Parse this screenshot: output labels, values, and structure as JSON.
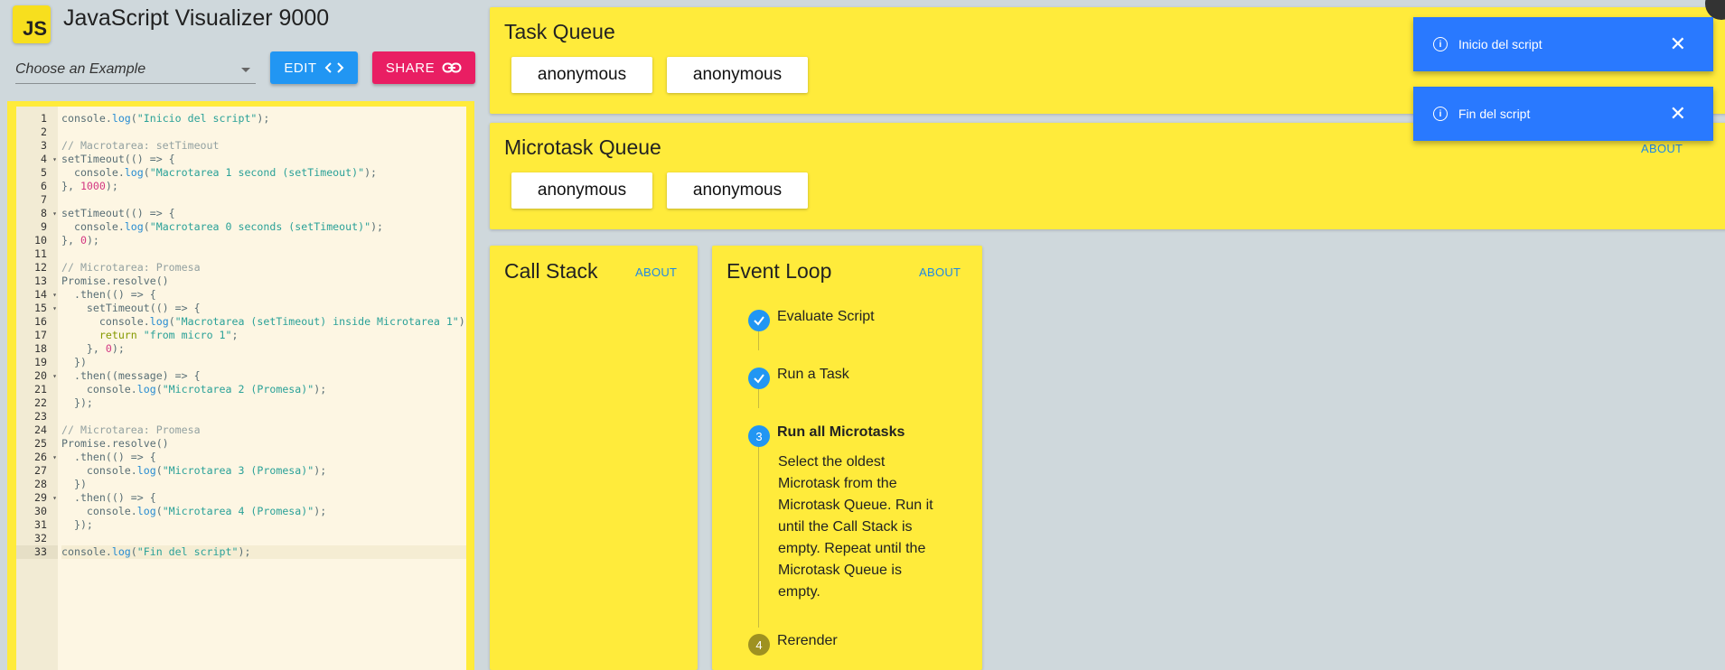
{
  "header": {
    "logo_text": "JS",
    "title": "JavaScript Visualizer 9000",
    "example_placeholder": "Choose an Example",
    "edit_label": "EDIT",
    "share_label": "SHARE"
  },
  "editor": {
    "active_line": 33,
    "lines": [
      "console.log(\"Inicio del script\");",
      "",
      "// Macrotarea: setTimeout",
      "setTimeout(() => {",
      "  console.log(\"Macrotarea 1 second (setTimeout)\");",
      "}, 1000);",
      "",
      "setTimeout(() => {",
      "  console.log(\"Macrotarea 0 seconds (setTimeout)\");",
      "}, 0);",
      "",
      "// Microtarea: Promesa",
      "Promise.resolve()",
      "  .then(() => {",
      "    setTimeout(() => {",
      "      console.log(\"Macrotarea (setTimeout) inside Microtarea 1\")",
      "      return \"from micro 1\";",
      "    }, 0);",
      "  })",
      "  .then((message) => {",
      "    console.log(\"Microtarea 2 (Promesa)\");",
      "  });",
      "",
      "// Microtarea: Promesa",
      "Promise.resolve()",
      "  .then(() => {",
      "    console.log(\"Microtarea 3 (Promesa)\");",
      "  })",
      "  .then(() => {",
      "    console.log(\"Microtarea 4 (Promesa)\");",
      "  });",
      "",
      "console.log(\"Fin del script\");"
    ],
    "fold_lines": [
      4,
      8,
      14,
      15,
      20,
      26,
      29
    ]
  },
  "task_queue": {
    "title": "Task Queue",
    "items": [
      "anonymous",
      "anonymous"
    ]
  },
  "microtask_queue": {
    "title": "Microtask Queue",
    "about": "ABOUT",
    "items": [
      "anonymous",
      "anonymous"
    ]
  },
  "call_stack": {
    "title": "Call Stack",
    "about": "ABOUT"
  },
  "event_loop": {
    "title": "Event Loop",
    "about": "ABOUT",
    "steps": [
      {
        "label": "Evaluate Script",
        "state": "done",
        "number": "1"
      },
      {
        "label": "Run a Task",
        "state": "done",
        "number": "2"
      },
      {
        "label": "Run all Microtasks",
        "state": "active",
        "number": "3",
        "description": "Select the oldest Microtask from the Microtask Queue. Run it until the Call Stack is empty. Repeat until the Microtask Queue is empty."
      },
      {
        "label": "Rerender",
        "state": "pending",
        "number": "4"
      }
    ]
  },
  "toasts": [
    {
      "message": "Inicio del script"
    },
    {
      "message": "Fin del script"
    }
  ],
  "icons": {
    "edit": "code-brackets-icon",
    "share": "link-icon",
    "toast_info": "info-icon",
    "toast_close": "close-icon",
    "step_done": "check-icon",
    "dropdown": "dropdown-arrow-icon"
  },
  "colors": {
    "panel": "#ffeb3b",
    "edit_button": "#2196f3",
    "share_button": "#e91e63",
    "toast": "#2979ff",
    "background": "#cfd8dc"
  }
}
